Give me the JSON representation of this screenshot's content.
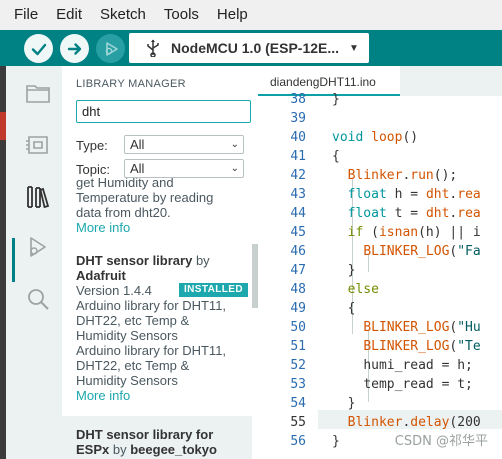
{
  "menu": [
    "File",
    "Edit",
    "Sketch",
    "Tools",
    "Help"
  ],
  "toolbar": {
    "board_name": "NodeMCU 1.0 (ESP-12E..."
  },
  "library_manager": {
    "title": "LIBRARY MANAGER",
    "search_value": "dht",
    "type_label": "Type:",
    "type_value": "All",
    "topic_label": "Topic:",
    "topic_value": "All",
    "cards": [
      {
        "desc_lines": [
          "get Humidity and",
          "Temperature by reading",
          "data from dht20."
        ],
        "more": "More info"
      },
      {
        "name": "DHT sensor library",
        "by": "by",
        "author": "Adafruit",
        "version": "Version 1.4.4",
        "badge": "INSTALLED",
        "desc_lines": [
          "Arduino library for DHT11,",
          "DHT22, etc Temp &",
          "Humidity Sensors",
          "Arduino library for DHT11,",
          "DHT22, etc Temp &",
          "Humidity Sensors"
        ],
        "more": "More info"
      },
      {
        "name": "DHT sensor library for",
        "name2": "ESPx",
        "by": "by",
        "author": "beegee_tokyo"
      }
    ]
  },
  "editor": {
    "tab_name": "diandengDHT11.ino",
    "line_numbers": [
      "38",
      "39",
      "40",
      "41",
      "42",
      "43",
      "44",
      "45",
      "46",
      "47",
      "48",
      "49",
      "50",
      "51",
      "52",
      "53",
      "54",
      "55",
      "56"
    ],
    "current_line": "55"
  },
  "watermark": "CSDN @祁华平"
}
